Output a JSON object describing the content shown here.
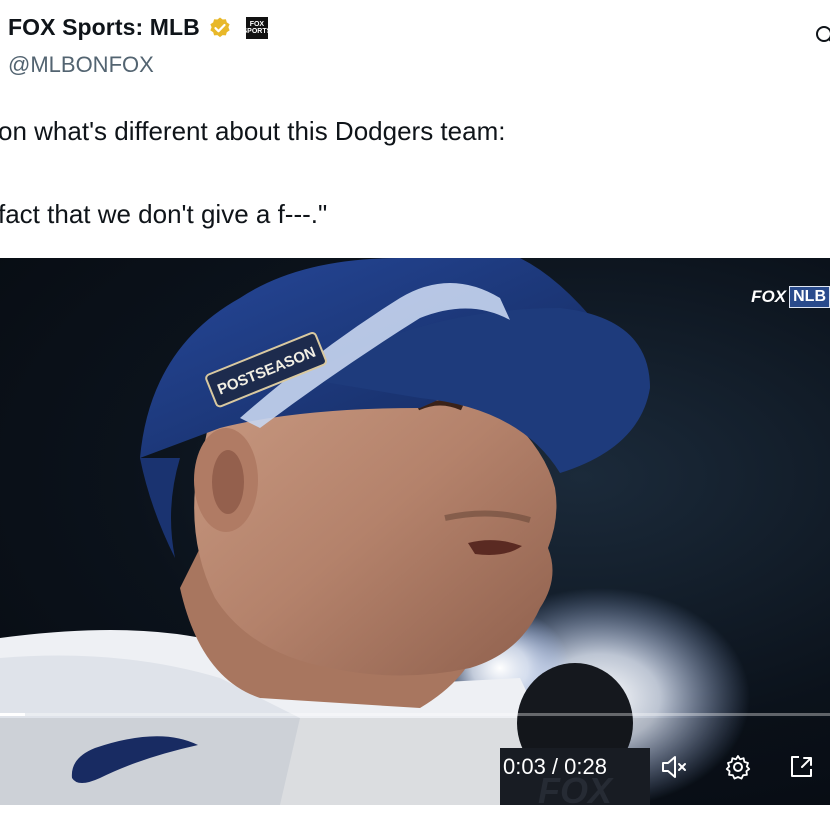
{
  "author": {
    "display_name": "FOX Sports: MLB",
    "handle": "@MLBONFOX",
    "affiliate_badge": "FOX SPORTS"
  },
  "tweet": {
    "line1": "on what's different about this Dodgers team:",
    "line2": "fact that we don't give a f---.\""
  },
  "video": {
    "network_bug": "FOX",
    "league_bug": "NLB",
    "cap_patch": "POSTSEASON",
    "mic_logo": "FOX",
    "progress": 0.03,
    "time_current": "0:03",
    "time_total": "0:28",
    "time_display": "0:03 / 0:28"
  },
  "icons": {
    "verified": "verified-gold-badge-icon",
    "grok": "grok-icon",
    "mute": "speaker-muted-icon",
    "settings": "gear-icon",
    "popout": "popout-icon"
  },
  "colors": {
    "verified_gold": "#e8b829",
    "handle_gray": "#536471",
    "cap_blue": "#1f3f8a"
  }
}
